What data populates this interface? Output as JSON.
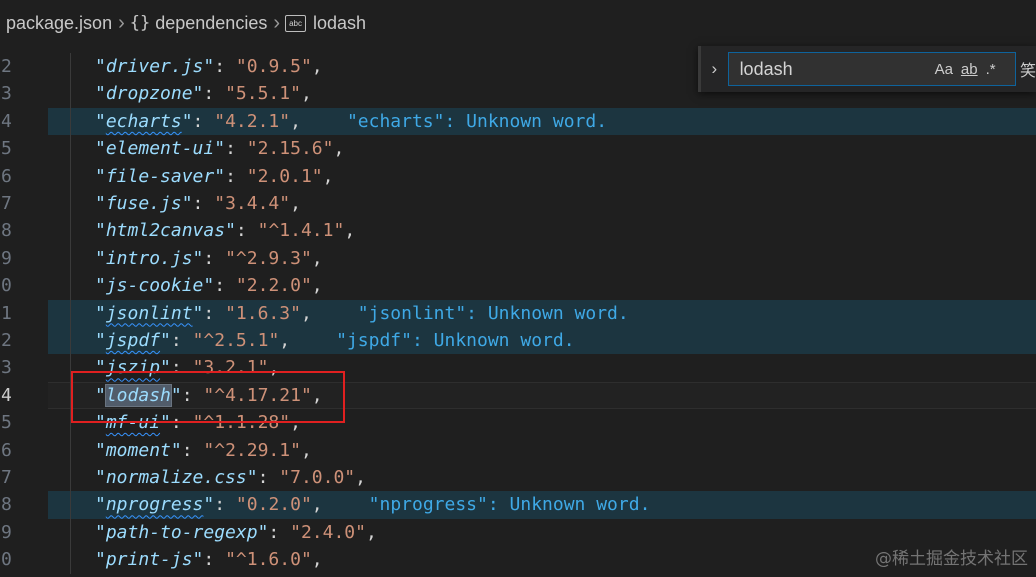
{
  "breadcrumb": {
    "file": "package.json",
    "braces": "{}",
    "section": "dependencies",
    "symbol": "lodash"
  },
  "find": {
    "query": "lodash",
    "match_case": "Aa",
    "whole_word": "ab",
    "regex": ".*"
  },
  "lines": [
    {
      "num": "2",
      "key": "driver.js",
      "value": "0.9.5",
      "comma": ",",
      "squig": false,
      "diag": "",
      "hl": false
    },
    {
      "num": "3",
      "key": "dropzone",
      "value": "5.5.1",
      "comma": ",",
      "squig": false,
      "diag": "",
      "hl": false
    },
    {
      "num": "4",
      "key": "echarts",
      "value": "4.2.1",
      "comma": ",",
      "squig": true,
      "diag": "\"echarts\": Unknown word.",
      "hl": true
    },
    {
      "num": "5",
      "key": "element-ui",
      "value": "2.15.6",
      "comma": ",",
      "squig": false,
      "diag": "",
      "hl": false
    },
    {
      "num": "6",
      "key": "file-saver",
      "value": "2.0.1",
      "comma": ",",
      "squig": false,
      "diag": "",
      "hl": false
    },
    {
      "num": "7",
      "key": "fuse.js",
      "value": "3.4.4",
      "comma": ",",
      "squig": false,
      "diag": "",
      "hl": false
    },
    {
      "num": "8",
      "key": "html2canvas",
      "value": "^1.4.1",
      "comma": ",",
      "squig": false,
      "diag": "",
      "hl": false
    },
    {
      "num": "9",
      "key": "intro.js",
      "value": "^2.9.3",
      "comma": ",",
      "squig": false,
      "diag": "",
      "hl": false
    },
    {
      "num": "0",
      "key": "js-cookie",
      "value": "2.2.0",
      "comma": ",",
      "squig": false,
      "diag": "",
      "hl": false
    },
    {
      "num": "1",
      "key": "jsonlint",
      "value": "1.6.3",
      "comma": ",",
      "squig": true,
      "diag": "\"jsonlint\": Unknown word.",
      "hl": true
    },
    {
      "num": "2",
      "key": "jspdf",
      "value": "^2.5.1",
      "comma": ",",
      "squig": true,
      "diag": "\"jspdf\": Unknown word.",
      "hl": true
    },
    {
      "num": "3",
      "key": "jszip",
      "value": "3.2.1",
      "comma": ",",
      "squig": true,
      "diag": "",
      "hl": false
    },
    {
      "num": "4",
      "key": "lodash",
      "value": "^4.17.21",
      "comma": ",",
      "squig": false,
      "diag": "",
      "hl": false,
      "current": true,
      "match": true
    },
    {
      "num": "5",
      "key": "mf-ui",
      "value": "^1.1.28",
      "comma": ",",
      "squig": true,
      "diag": "",
      "hl": false
    },
    {
      "num": "6",
      "key": "moment",
      "value": "^2.29.1",
      "comma": ",",
      "squig": false,
      "diag": "",
      "hl": false
    },
    {
      "num": "7",
      "key": "normalize.css",
      "value": "7.0.0",
      "comma": ",",
      "squig": false,
      "diag": "",
      "hl": false
    },
    {
      "num": "8",
      "key": "nprogress",
      "value": "0.2.0",
      "comma": ",",
      "squig": true,
      "diag": "\"nprogress\": Unknown word.",
      "hl": true
    },
    {
      "num": "9",
      "key": "path-to-regexp",
      "value": "2.4.0",
      "comma": ",",
      "squig": false,
      "diag": "",
      "hl": false
    },
    {
      "num": "0",
      "key": "print-js",
      "value": "^1.6.0",
      "comma": ",",
      "squig": false,
      "diag": "",
      "hl": false
    }
  ],
  "watermark": "@稀土掘金技术社区"
}
